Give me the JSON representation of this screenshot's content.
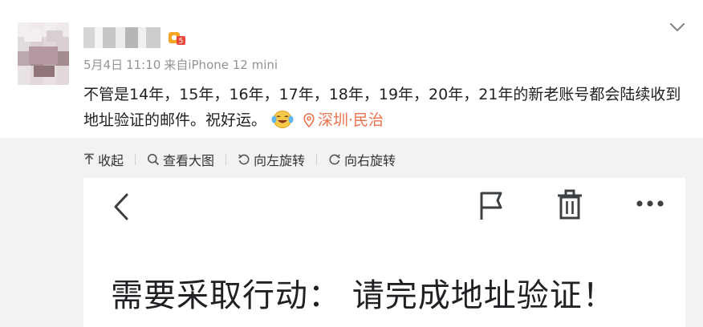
{
  "post": {
    "meta": {
      "date": "5月4日",
      "time": "11:10",
      "source_prefix": "来自",
      "device": "iPhone 12 mini"
    },
    "text": "不管是14年，15年，16年，17年，18年，19年，20年，21年的新老账号都会陆续收到地址验证的邮件。祝好运。",
    "location": "深圳·民治",
    "emoji": "laugh-cry-emoji"
  },
  "toolbar": {
    "collapse": "收起",
    "view_large": "查看大图",
    "rotate_left": "向左旋转",
    "rotate_right": "向右旋转"
  },
  "screenshot": {
    "title": "需要采取行动：  请完成地址验证！",
    "icons": [
      "back-arrow-icon",
      "flag-icon",
      "trash-icon",
      "more-dots-icon"
    ]
  },
  "colors": {
    "location": "#eb7350",
    "meta": "#939393",
    "media_bg": "#f2f2f5"
  }
}
